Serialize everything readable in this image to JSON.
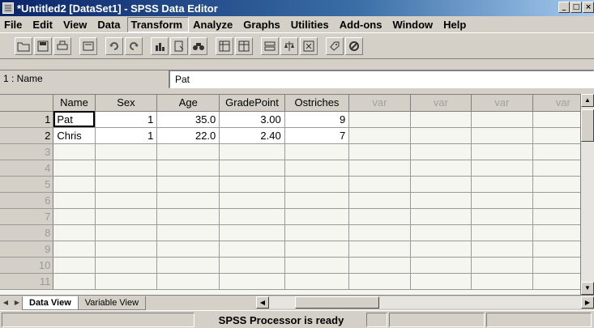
{
  "window": {
    "title": "*Untitled2 [DataSet1] - SPSS Data Editor",
    "controls": [
      "_",
      "□",
      "×"
    ]
  },
  "menu": [
    "File",
    "Edit",
    "View",
    "Data",
    "Transform",
    "Analyze",
    "Graphs",
    "Utilities",
    "Add-ons",
    "Window",
    "Help"
  ],
  "toolbar": {
    "buttons": [
      "open-icon",
      "save-icon",
      "print-icon",
      "dialog-recall-icon",
      "undo-icon",
      "redo-icon",
      "goto-chart-icon",
      "goto-case-icon",
      "find-icon",
      "insert-cases-icon",
      "insert-variable-icon",
      "split-file-icon",
      "weight-cases-icon",
      "select-cases-icon",
      "value-labels-icon",
      "use-sets-icon"
    ]
  },
  "cell_editor": {
    "reference": "1 : Name",
    "value": "Pat"
  },
  "grid": {
    "columns": [
      "Name",
      "Sex",
      "Age",
      "GradePoint",
      "Ostriches",
      "var",
      "var",
      "var",
      "var"
    ],
    "rows": [
      {
        "n": "1",
        "cells": [
          "Pat",
          "1",
          "35.0",
          "3.00",
          "9"
        ]
      },
      {
        "n": "2",
        "cells": [
          "Chris",
          "1",
          "22.0",
          "2.40",
          "7"
        ]
      }
    ],
    "empty_rows": [
      "3",
      "4",
      "5",
      "6",
      "7",
      "8",
      "9",
      "10",
      "11"
    ]
  },
  "tabs": [
    "Data View",
    "Variable View"
  ],
  "status": "SPSS Processor is ready",
  "colors": {
    "titlebar": "#0a246a",
    "chrome": "#d4d0c8",
    "grid_bg": "#f6f6f0"
  }
}
